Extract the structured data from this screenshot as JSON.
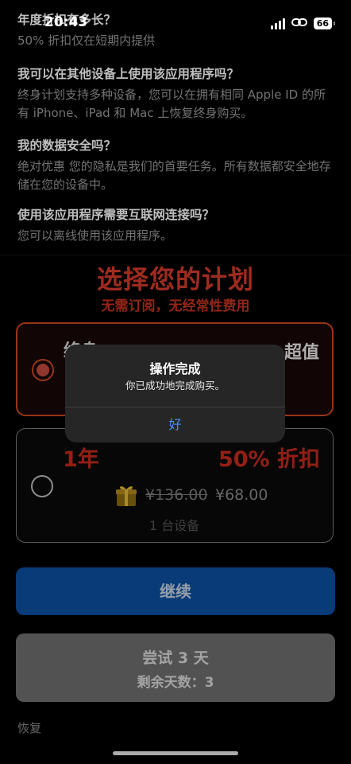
{
  "status_bar": {
    "time": "20:43",
    "battery": "66"
  },
  "faq": [
    {
      "q": "年度折扣有多长？",
      "a": "50% 折扣仅在短期内提供"
    },
    {
      "q": "我可以在其他设备上使用该应用程序吗？",
      "a": "终身计划支持多种设备，您可以在拥有相同 Apple ID 的所有 iPhone、iPad 和 Mac 上恢复终身购买。"
    },
    {
      "q": "我的数据安全吗？",
      "a": "绝对优惠 您的隐私是我们的首要任务。所有数据都安全地存储在您的设备中。"
    },
    {
      "q": "使用该应用程序需要互联网连接吗？",
      "a": "您可以离线使用该应用程序。"
    }
  ],
  "headline": {
    "title": "选择您的计划",
    "subtitle": "无需订阅，无经常性费用"
  },
  "plans": [
    {
      "partial_label": "终身",
      "tag": "超值"
    },
    {
      "name": "1年",
      "discount": "50% 折扣",
      "old_price": "¥136.00",
      "new_price": "¥68.00",
      "devices": "1 台设备"
    }
  ],
  "buttons": {
    "continue": "继续",
    "trial_line1": "尝试 3 天",
    "trial_line2": "剩余天数：3",
    "restore": "恢复"
  },
  "alert": {
    "title": "操作完成",
    "message": "你已成功地完成购买。",
    "ok": "好"
  },
  "colors": {
    "accent_red": "#c42a1c",
    "button_blue": "#0b4fa0",
    "alert_link": "#4a8fff"
  }
}
